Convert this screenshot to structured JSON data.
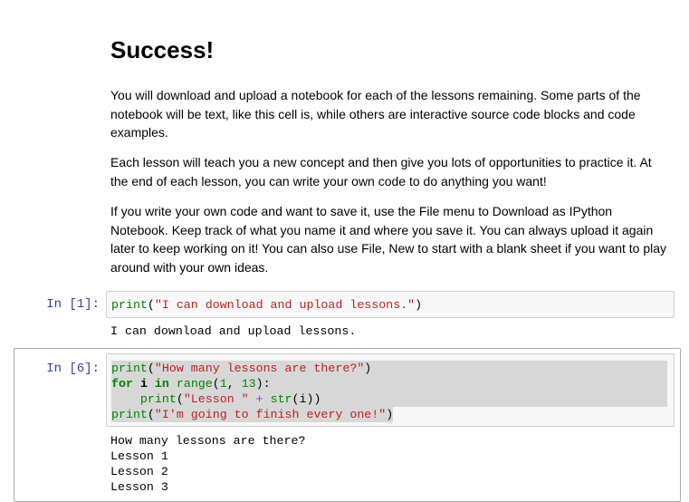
{
  "markdown": {
    "heading": "Success!",
    "paragraphs": [
      "You will download and upload a notebook for each of the lessons remaining. Some parts of the notebook will be text, like this cell is, while others are interactive source code blocks and code examples.",
      "Each lesson will teach you a new concept and then give you lots of opportunities to practice it. At the end of each lesson, you can write your own code to do anything you want!",
      "If you write your own code and want to save it, use the File menu to Download as IPython Notebook. Keep track of what you name it and where you save it. You can always upload it again later to keep working on it! You can also use File, New to start with a blank sheet if you want to play around with your own ideas."
    ]
  },
  "cells": [
    {
      "prompt": "In [1]:",
      "code_lines": [
        "print(\"I can download and upload lessons.\")"
      ],
      "output": "I can download and upload lessons."
    },
    {
      "prompt": "In [6]:",
      "code_lines": [
        "print(\"How many lessons are there?\")",
        "for i in range(1, 13):",
        "    print(\"Lesson \" + str(i))",
        "print(\"I'm going to finish every one!\")"
      ],
      "output_lines": [
        "How many lessons are there?",
        "Lesson 1",
        "Lesson 2",
        "Lesson 3"
      ]
    }
  ]
}
